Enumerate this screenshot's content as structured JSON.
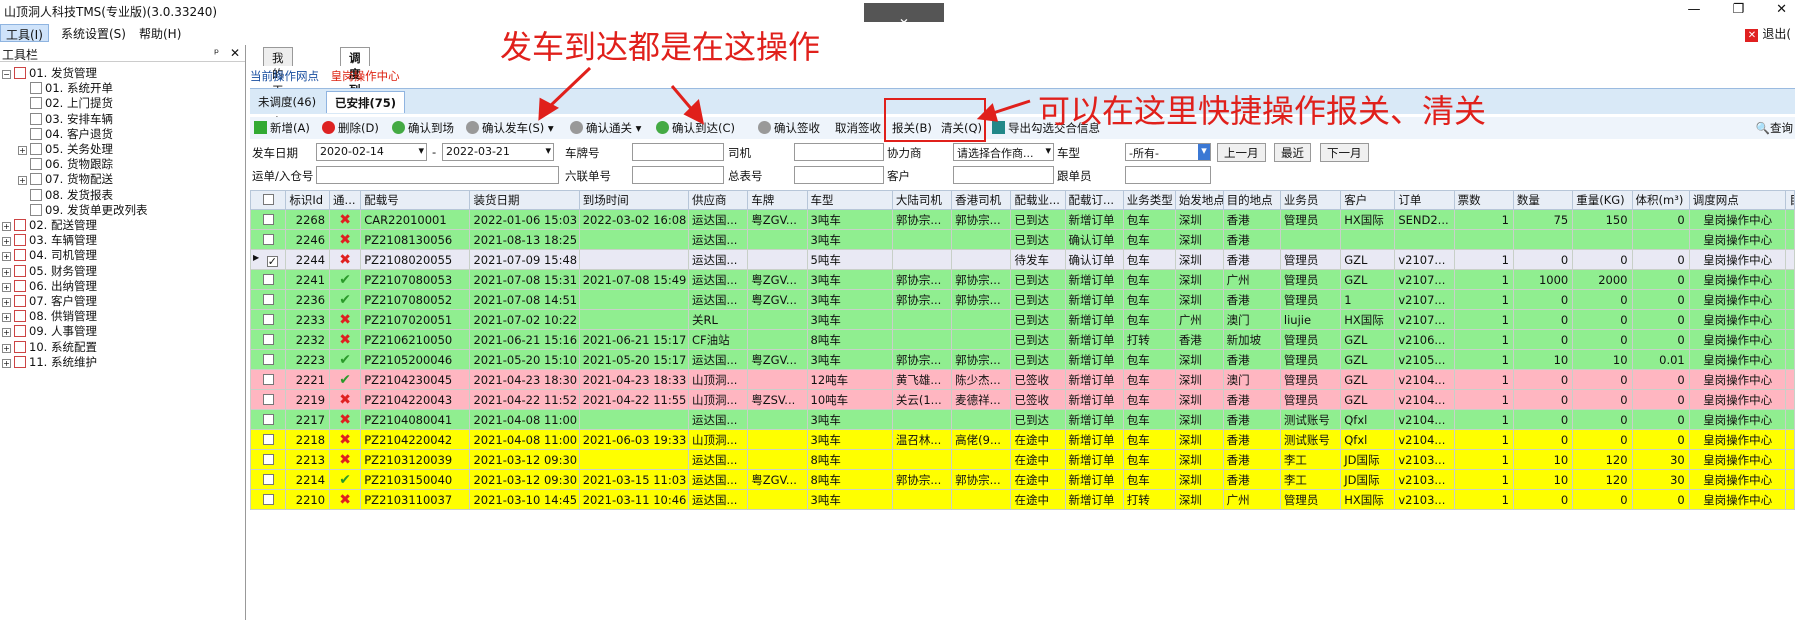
{
  "window": {
    "title": "山顶洞人科技TMS(专业版)(3.0.33240)",
    "collapse_icon": "chevron-down-icon",
    "controls": [
      "—",
      "❐",
      "✕"
    ]
  },
  "menu": {
    "items": [
      "工具(I)",
      "系统设置(S)",
      "帮助(H)"
    ],
    "exit_label": "退出("
  },
  "sidebar": {
    "title": "工具栏",
    "pin": "ᵖ",
    "close": "✕",
    "items": [
      {
        "label": "01. 发货管理",
        "level": 0,
        "expanded": true
      },
      {
        "label": "01. 系统开单",
        "level": 1
      },
      {
        "label": "02. 上门提货",
        "level": 1
      },
      {
        "label": "03. 安排车辆",
        "level": 1
      },
      {
        "label": "04. 客户退货",
        "level": 1
      },
      {
        "label": "05. 关务处理",
        "level": 1,
        "expandable": true
      },
      {
        "label": "06. 货物跟踪",
        "level": 1
      },
      {
        "label": "07. 货物配送",
        "level": 1,
        "expandable": true
      },
      {
        "label": "08. 发货报表",
        "level": 1
      },
      {
        "label": "09. 发货单更改列表",
        "level": 1
      },
      {
        "label": "02. 配送管理",
        "level": 0
      },
      {
        "label": "03. 车辆管理",
        "level": 0
      },
      {
        "label": "04. 司机管理",
        "level": 0
      },
      {
        "label": "05. 财务管理",
        "level": 0
      },
      {
        "label": "06. 出纳管理",
        "level": 0
      },
      {
        "label": "07. 客户管理",
        "level": 0
      },
      {
        "label": "08. 供销管理",
        "level": 0
      },
      {
        "label": "09. 人事管理",
        "level": 0
      },
      {
        "label": "10. 系统配置",
        "level": 0
      },
      {
        "label": "11. 系统维护",
        "level": 0
      }
    ]
  },
  "tabs": [
    "我的工作台",
    "调度列表"
  ],
  "current_site": {
    "label": "当前操作网点",
    "value": "皇岗操作中心"
  },
  "subtabs": [
    "未调度(46)",
    "已安排(75)"
  ],
  "toolbar": {
    "add": "新增(A)",
    "delete": "删除(D)",
    "confirm_arrive_site": "确认到场",
    "confirm_depart": "确认发车(S)",
    "confirm_customs": "确认通关",
    "confirm_arrive": "确认到达(C)",
    "confirm_sign": "确认签收",
    "cancel_sign": "取消签收",
    "declare": "报关(B)",
    "clear": "清关(Q)",
    "export": "导出勾选交合信息",
    "search": "查询"
  },
  "filters": {
    "depart_date_label": "发车日期",
    "date_from": "2020-02-14",
    "date_sep": "-",
    "date_to": "2022-03-21",
    "plate_label": "车牌号",
    "driver_label": "司机",
    "partner_label": "协力商",
    "partner_placeholder": "请选择合作商...",
    "vehicle_type_label": "车型",
    "vehicle_type_value": "-所有-",
    "prev_month": "上一月",
    "recent": "最近",
    "next_month": "下一月",
    "waybill_label": "运单/入仓号",
    "six_label": "六联单号",
    "master_label": "总表号",
    "customer_label": "客户",
    "follower_label": "跟单员"
  },
  "table": {
    "columns": [
      "",
      "标识Id",
      "通...",
      "配载号",
      "装货日期",
      "到场时间",
      "供应商",
      "车牌",
      "车型",
      "大陆司机",
      "香港司机",
      "配载业...",
      "配载订...",
      "业务类型",
      "始发地点",
      "目的地点",
      "业务员",
      "客户",
      "订单",
      "票数",
      "数量",
      "重量(KG)",
      "体积(m³)",
      "调度网点",
      "目"
    ],
    "rows": [
      {
        "color": "green",
        "check": false,
        "id": "2268",
        "pass": "no",
        "load_no": "CAR22010001",
        "load_date": "2022-01-06 15:03",
        "arrive": "2022-03-02 16:08",
        "supplier": "运达国...",
        "plate": "粤ZGV...",
        "vtype": "3吨车",
        "cn_driver": "郭协宗...",
        "hk_driver": "郭协宗...",
        "status": "已到达",
        "order_status": "新增订单",
        "biz": "包车",
        "from": "深圳",
        "to": "香港",
        "staff": "管理员",
        "customer": "HX国际",
        "order": "SEND2...",
        "tickets": "1",
        "qty": "75",
        "weight": "150",
        "volume": "0",
        "site": "皇岗操作中心"
      },
      {
        "color": "green",
        "check": false,
        "id": "2246",
        "pass": "no",
        "load_no": "PZ2108130056",
        "load_date": "2021-08-13 18:25",
        "arrive": "",
        "supplier": "运达国...",
        "plate": "",
        "vtype": "3吨车",
        "cn_driver": "",
        "hk_driver": "",
        "status": "已到达",
        "order_status": "确认订单",
        "biz": "包车",
        "from": "深圳",
        "to": "香港",
        "staff": "",
        "customer": "",
        "order": "",
        "tickets": "",
        "qty": "",
        "weight": "",
        "volume": "",
        "site": "皇岗操作中心"
      },
      {
        "color": "sel",
        "check": true,
        "id": "2244",
        "pass": "no",
        "load_no": "PZ2108020055",
        "load_date": "2021-07-09 15:48",
        "arrive": "",
        "supplier": "运达国...",
        "plate": "",
        "vtype": "5吨车",
        "cn_driver": "",
        "hk_driver": "",
        "status": "待发车",
        "order_status": "确认订单",
        "biz": "包车",
        "from": "深圳",
        "to": "香港",
        "staff": "管理员",
        "customer": "GZL",
        "order": "v2107...",
        "tickets": "1",
        "qty": "0",
        "weight": "0",
        "volume": "0",
        "site": "皇岗操作中心"
      },
      {
        "color": "green",
        "check": false,
        "id": "2241",
        "pass": "ok",
        "load_no": "PZ2107080053",
        "load_date": "2021-07-08 15:31",
        "arrive": "2021-07-08 15:49",
        "supplier": "运达国...",
        "plate": "粤ZGV...",
        "vtype": "3吨车",
        "cn_driver": "郭协宗...",
        "hk_driver": "郭协宗...",
        "status": "已到达",
        "order_status": "新增订单",
        "biz": "包车",
        "from": "深圳",
        "to": "广州",
        "staff": "管理员",
        "customer": "GZL",
        "order": "v2107...",
        "tickets": "1",
        "qty": "1000",
        "weight": "2000",
        "volume": "0",
        "site": "皇岗操作中心"
      },
      {
        "color": "green",
        "check": false,
        "id": "2236",
        "pass": "ok",
        "load_no": "PZ2107080052",
        "load_date": "2021-07-08 14:51",
        "arrive": "",
        "supplier": "运达国...",
        "plate": "粤ZGV...",
        "vtype": "3吨车",
        "cn_driver": "郭协宗...",
        "hk_driver": "郭协宗...",
        "status": "已到达",
        "order_status": "新增订单",
        "biz": "包车",
        "from": "深圳",
        "to": "香港",
        "staff": "管理员",
        "customer": "1",
        "order": "v2107...",
        "tickets": "1",
        "qty": "0",
        "weight": "0",
        "volume": "0",
        "site": "皇岗操作中心"
      },
      {
        "color": "green",
        "check": false,
        "id": "2233",
        "pass": "no",
        "load_no": "PZ2107020051",
        "load_date": "2021-07-02 10:22",
        "arrive": "",
        "supplier": "关RL",
        "plate": "",
        "vtype": "3吨车",
        "cn_driver": "",
        "hk_driver": "",
        "status": "已到达",
        "order_status": "新增订单",
        "biz": "包车",
        "from": "广州",
        "to": "澳门",
        "staff": "liujie",
        "customer": "HX国际",
        "order": "v2107...",
        "tickets": "1",
        "qty": "0",
        "weight": "0",
        "volume": "0",
        "site": "皇岗操作中心"
      },
      {
        "color": "green",
        "check": false,
        "id": "2232",
        "pass": "no",
        "load_no": "PZ2106210050",
        "load_date": "2021-06-21 15:16",
        "arrive": "2021-06-21 15:17",
        "supplier": "CF油站",
        "plate": "",
        "vtype": "8吨车",
        "cn_driver": "",
        "hk_driver": "",
        "status": "已到达",
        "order_status": "新增订单",
        "biz": "打转",
        "from": "香港",
        "to": "新加坡",
        "staff": "管理员",
        "customer": "GZL",
        "order": "v2106...",
        "tickets": "1",
        "qty": "0",
        "weight": "0",
        "volume": "0",
        "site": "皇岗操作中心"
      },
      {
        "color": "green",
        "check": false,
        "id": "2223",
        "pass": "ok",
        "load_no": "PZ2105200046",
        "load_date": "2021-05-20 15:10",
        "arrive": "2021-05-20 15:17",
        "supplier": "运达国...",
        "plate": "粤ZGV...",
        "vtype": "3吨车",
        "cn_driver": "郭协宗...",
        "hk_driver": "郭协宗...",
        "status": "已到达",
        "order_status": "新增订单",
        "biz": "包车",
        "from": "深圳",
        "to": "香港",
        "staff": "管理员",
        "customer": "GZL",
        "order": "v2105...",
        "tickets": "1",
        "qty": "10",
        "weight": "10",
        "volume": "0.01",
        "site": "皇岗操作中心"
      },
      {
        "color": "pink",
        "check": false,
        "id": "2221",
        "pass": "ok",
        "load_no": "PZ2104230045",
        "load_date": "2021-04-23 18:30",
        "arrive": "2021-04-23 18:33",
        "supplier": "山顶洞...",
        "plate": "",
        "vtype": "12吨车",
        "cn_driver": "黄飞雄...",
        "hk_driver": "陈少杰...",
        "status": "已签收",
        "order_status": "新增订单",
        "biz": "包车",
        "from": "深圳",
        "to": "澳门",
        "staff": "管理员",
        "customer": "GZL",
        "order": "v2104...",
        "tickets": "1",
        "qty": "0",
        "weight": "0",
        "volume": "0",
        "site": "皇岗操作中心"
      },
      {
        "color": "pink",
        "check": false,
        "id": "2219",
        "pass": "no",
        "load_no": "PZ2104220043",
        "load_date": "2021-04-22 11:52",
        "arrive": "2021-04-22 11:55",
        "supplier": "山顶洞...",
        "plate": "粤ZSV...",
        "vtype": "10吨车",
        "cn_driver": "关云(1...",
        "hk_driver": "麦德祥...",
        "status": "已签收",
        "order_status": "新增订单",
        "biz": "包车",
        "from": "深圳",
        "to": "香港",
        "staff": "管理员",
        "customer": "GZL",
        "order": "v2104...",
        "tickets": "1",
        "qty": "0",
        "weight": "0",
        "volume": "0",
        "site": "皇岗操作中心"
      },
      {
        "color": "green",
        "check": false,
        "id": "2217",
        "pass": "no",
        "load_no": "PZ2104080041",
        "load_date": "2021-04-08 11:00",
        "arrive": "",
        "supplier": "运达国...",
        "plate": "",
        "vtype": "3吨车",
        "cn_driver": "",
        "hk_driver": "",
        "status": "已到达",
        "order_status": "新增订单",
        "biz": "包车",
        "from": "深圳",
        "to": "香港",
        "staff": "测试账号",
        "customer": "Qfxl",
        "order": "v2104...",
        "tickets": "1",
        "qty": "0",
        "weight": "0",
        "volume": "0",
        "site": "皇岗操作中心"
      },
      {
        "color": "yellow",
        "check": false,
        "id": "2218",
        "pass": "no",
        "load_no": "PZ2104220042",
        "load_date": "2021-04-08 11:00",
        "arrive": "2021-06-03 19:33",
        "supplier": "山顶洞...",
        "plate": "",
        "vtype": "3吨车",
        "cn_driver": "温召林...",
        "hk_driver": "高佬(9...",
        "status": "在途中",
        "order_status": "新增订单",
        "biz": "包车",
        "from": "深圳",
        "to": "香港",
        "staff": "测试账号",
        "customer": "Qfxl",
        "order": "v2104...",
        "tickets": "1",
        "qty": "0",
        "weight": "0",
        "volume": "0",
        "site": "皇岗操作中心"
      },
      {
        "color": "yellow",
        "check": false,
        "id": "2213",
        "pass": "no",
        "load_no": "PZ2103120039",
        "load_date": "2021-03-12 09:30",
        "arrive": "",
        "supplier": "运达国...",
        "plate": "",
        "vtype": "8吨车",
        "cn_driver": "",
        "hk_driver": "",
        "status": "在途中",
        "order_status": "新增订单",
        "biz": "包车",
        "from": "深圳",
        "to": "香港",
        "staff": "李工",
        "customer": "JD国际",
        "order": "v2103...",
        "tickets": "1",
        "qty": "10",
        "weight": "120",
        "volume": "30",
        "site": "皇岗操作中心"
      },
      {
        "color": "yellow",
        "check": false,
        "id": "2214",
        "pass": "ok",
        "load_no": "PZ2103150040",
        "load_date": "2021-03-12 09:30",
        "arrive": "2021-03-15 11:03",
        "supplier": "运达国...",
        "plate": "粤ZGV...",
        "vtype": "8吨车",
        "cn_driver": "郭协宗...",
        "hk_driver": "郭协宗...",
        "status": "在途中",
        "order_status": "新增订单",
        "biz": "包车",
        "from": "深圳",
        "to": "香港",
        "staff": "李工",
        "customer": "JD国际",
        "order": "v2103...",
        "tickets": "1",
        "qty": "10",
        "weight": "120",
        "volume": "30",
        "site": "皇岗操作中心"
      },
      {
        "color": "yellow",
        "check": false,
        "id": "2210",
        "pass": "no",
        "load_no": "PZ2103110037",
        "load_date": "2021-03-10 14:45",
        "arrive": "2021-03-11 10:46",
        "supplier": "运达国...",
        "plate": "",
        "vtype": "3吨车",
        "cn_driver": "",
        "hk_driver": "",
        "status": "在途中",
        "order_status": "新增订单",
        "biz": "打转",
        "from": "深圳",
        "to": "广州",
        "staff": "管理员",
        "customer": "HX国际",
        "order": "v2103...",
        "tickets": "1",
        "qty": "0",
        "weight": "0",
        "volume": "0",
        "site": "皇岗操作中心"
      }
    ]
  },
  "annotations": {
    "depart_arrive": "发车到达都是在这操作",
    "customs": "可以在这里快捷操作报关、清关"
  },
  "colors": {
    "green_row": "#90ee90",
    "pink_row": "#ffb6c1",
    "yellow_row": "#ffff00",
    "annotation": "#e0201b"
  }
}
